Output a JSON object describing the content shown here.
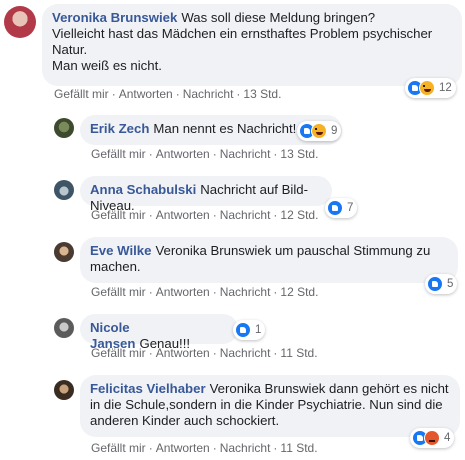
{
  "actions": {
    "like": "Gefällt mir",
    "reply": "Antworten",
    "message": "Nachricht",
    "sep": "·"
  },
  "comments": [
    {
      "author": "Veronika Brunswiek",
      "text": "Was soll diese Meldung bringen?\nVielleicht hast das Mädchen ein ernsthaftes Problem psychischer Natur.\nMan weiß es nicht.",
      "time": "13 Std.",
      "reactions": [
        "like-icon",
        "haha-icon"
      ],
      "count": "12"
    },
    {
      "author": "Erik Zech",
      "text": "Man nennt es Nachricht!",
      "time": "13 Std.",
      "reactions": [
        "like-icon",
        "haha-icon"
      ],
      "count": "9"
    },
    {
      "author": "Anna Schabulski",
      "text": "Nachricht auf Bild-Niveau.",
      "time": "12 Std.",
      "reactions": [
        "like-icon"
      ],
      "count": "7"
    },
    {
      "author": "Eve Wilke",
      "text": "Veronika Brunswiek um pauschal Stimmung zu machen.",
      "time": "12 Std.",
      "reactions": [
        "like-icon"
      ],
      "count": "5"
    },
    {
      "author": "Nicole Jansen",
      "text": "Genau!!!",
      "time": "11 Std.",
      "reactions": [
        "like-icon"
      ],
      "count": "1"
    },
    {
      "author": "Felicitas Vielhaber",
      "text": "Veronika Brunswiek dann gehört es nicht in die Schule,sondern in die Kinder Psychiatrie. Nun sind die anderen Kinder auch schockiert.",
      "time": "11 Std.",
      "reactions": [
        "like-icon",
        "angry-icon"
      ],
      "count": "4"
    }
  ],
  "colors": {
    "author": "#385898",
    "bubble": "#f0f2f5",
    "meta": "#65676b",
    "like": "#1877f2"
  }
}
